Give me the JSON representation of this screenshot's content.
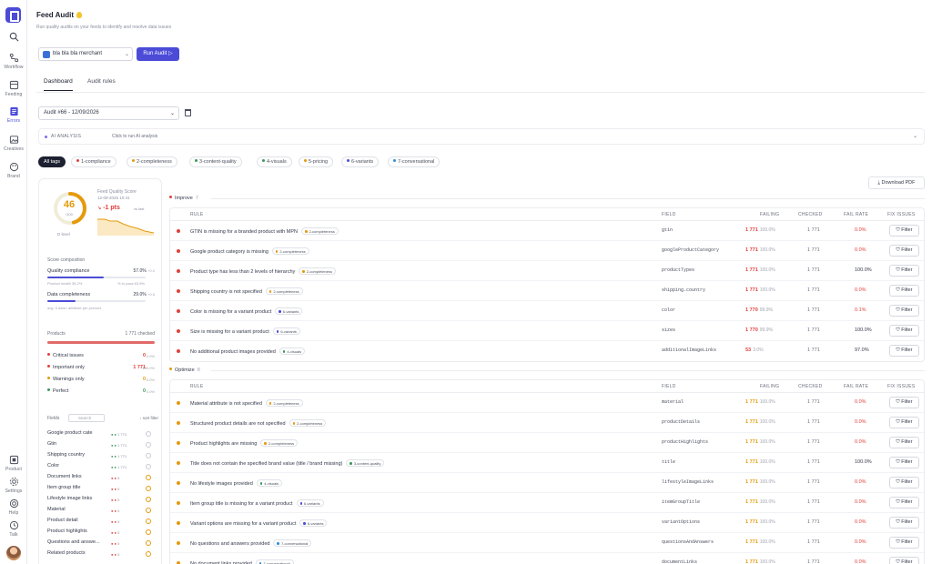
{
  "rail": {
    "items": [
      {
        "label": ""
      },
      {
        "label": "Workflow"
      },
      {
        "label": "Feeding"
      },
      {
        "label": "Errors"
      },
      {
        "label": "Creatives"
      },
      {
        "label": "Brand"
      }
    ],
    "bottom": [
      {
        "label": "Product"
      },
      {
        "label": "Settings"
      },
      {
        "label": "Help"
      },
      {
        "label": "Talk"
      }
    ]
  },
  "header": {
    "title": "Feed Audit",
    "subtitle": "Run quality audits on your feeds to identify and resolve data issues"
  },
  "merchant": {
    "name": "bla bla bla merchant"
  },
  "run_audit_label": "Run Audit ▷",
  "tabs": [
    {
      "label": "Dashboard"
    },
    {
      "label": "Audit rules"
    }
  ],
  "audit_select": {
    "value": "Audit #66 - 12/09/2026"
  },
  "ai": {
    "label": "AI ANALYSIS",
    "link": "Click to run AI analysis"
  },
  "chips": [
    {
      "label": "All tags",
      "color": ""
    },
    {
      "label": "1-compliance",
      "color": "#e0403a"
    },
    {
      "label": "2-completeness",
      "color": "#e59a0c"
    },
    {
      "label": "3-content-quality",
      "color": "#3a9a5a"
    },
    {
      "label": "4-visuals",
      "color": "#3a9a5a"
    },
    {
      "label": "5-pricing",
      "color": "#e59a0c"
    },
    {
      "label": "6-variants",
      "color": "#4b4bd8"
    },
    {
      "label": "7-conversational",
      "color": "#2f8fd8"
    }
  ],
  "score": {
    "value": "46",
    "value_pct": 46,
    "sub": "/100",
    "foot": "D level",
    "title": "Feed Quality Score",
    "date": "12-09-2026 10:41",
    "delta": "-1 pts",
    "delta_sub": "vs last",
    "composition_label": "Score composition",
    "quality_label": "Quality compliance",
    "quality_value": "57.0%",
    "quality_delta": "+0.2",
    "quality_pct": 57.0,
    "health_label": "Product health 36.2%",
    "health_right": "% to pass 63.8%",
    "data_label": "Data completeness",
    "data_value": "29.0%",
    "data_delta": "+0.5",
    "data_pct": 29.0,
    "data_note": "avg. 5 data / attribute per product"
  },
  "products": {
    "label": "Products",
    "total": "1 771 checked",
    "rows": [
      {
        "label": "Critical issues",
        "value": "0",
        "pct": "0.0%",
        "color": "#e0403a"
      },
      {
        "label": "Important only",
        "value": "1 771",
        "pct": "100.0%",
        "color": "#e0403a"
      },
      {
        "label": "Warnings only",
        "value": "0",
        "pct": "0.0%",
        "color": "#e59a0c"
      },
      {
        "label": "Perfect",
        "value": "0",
        "pct": "0.0%",
        "color": "#3a9a5a"
      }
    ]
  },
  "fields": {
    "label": "Fields",
    "search_placeholder": "Search",
    "sort": "↓ sort filter",
    "rows": [
      {
        "name": "Google product cate",
        "a": "1 771",
        "warn": false
      },
      {
        "name": "Gtin",
        "a": "1 771",
        "warn": false
      },
      {
        "name": "Shipping country",
        "a": "1 771",
        "warn": false
      },
      {
        "name": "Color",
        "a": "1 771",
        "warn": false
      },
      {
        "name": "Document links",
        "a": "0",
        "warn": true
      },
      {
        "name": "Item group title",
        "a": "0",
        "warn": true
      },
      {
        "name": "Lifestyle image links",
        "a": "0",
        "warn": true
      },
      {
        "name": "Material",
        "a": "0",
        "warn": true
      },
      {
        "name": "Product detail",
        "a": "0",
        "warn": true
      },
      {
        "name": "Product highlights",
        "a": "0",
        "warn": true
      },
      {
        "name": "Questions and answe...",
        "a": "0",
        "warn": true
      },
      {
        "name": "Related products",
        "a": "0",
        "warn": true
      }
    ]
  },
  "download_label": "⤓ Download PDF",
  "columns": {
    "rule": "RULE",
    "field": "FIELD",
    "failing": "FAILING",
    "checked": "CHECKED",
    "fail_rate": "FAIL RATE",
    "fix": "FIX ISSUES"
  },
  "filter_label": "⛉ Filter",
  "improve": {
    "label": "Improve",
    "count": "7",
    "rows": [
      {
        "rule": "GTIN is missing for a branded product with MPN",
        "tag": "2-completeness",
        "tag_color": "#e59a0c",
        "field": "gtin",
        "failing": "1 771",
        "fail_pct": "100.0%",
        "checked": "1 771",
        "rate": "0.0%"
      },
      {
        "rule": "Google product category is missing",
        "tag": "2-completeness",
        "tag_color": "#e59a0c",
        "field": "googleProductCategory",
        "failing": "1 771",
        "fail_pct": "100.0%",
        "checked": "1 771",
        "rate": "0.0%"
      },
      {
        "rule": "Product type has less than 2 levels of hierarchy",
        "tag": "2-completeness",
        "tag_color": "#e59a0c",
        "field": "productTypes",
        "failing": "1 771",
        "fail_pct": "100.0%",
        "checked": "1 771",
        "rate": "100.0%"
      },
      {
        "rule": "Shipping country is not specified",
        "tag": "2-completeness",
        "tag_color": "#e59a0c",
        "field": "shipping.country",
        "failing": "1 771",
        "fail_pct": "100.0%",
        "checked": "1 771",
        "rate": "0.0%"
      },
      {
        "rule": "Color is missing for a variant product",
        "tag": "6-variants",
        "tag_color": "#4b4bd8",
        "field": "color",
        "failing": "1 770",
        "fail_pct": "99.9%",
        "checked": "1 771",
        "rate": "0.1%"
      },
      {
        "rule": "Size is missing for a variant product",
        "tag": "6-variants",
        "tag_color": "#4b4bd8",
        "field": "sizes",
        "failing": "1 770",
        "fail_pct": "99.9%",
        "checked": "1 771",
        "rate": "100.0%"
      },
      {
        "rule": "No additional product images provided",
        "tag": "4-visuals",
        "tag_color": "#3a9a5a",
        "field": "additionalImageLinks",
        "failing": "53",
        "fail_pct": "3.0%",
        "checked": "1 771",
        "rate": "97.0%"
      }
    ]
  },
  "optimize": {
    "label": "Optimize",
    "count": "8",
    "rows": [
      {
        "rule": "Material attribute is not specified",
        "tag": "2-completeness",
        "tag_color": "#e59a0c",
        "field": "material",
        "failing": "1 771",
        "fail_pct": "100.0%",
        "checked": "1 771",
        "rate": "0.0%"
      },
      {
        "rule": "Structured product details are not specified",
        "tag": "2-completeness",
        "tag_color": "#e59a0c",
        "field": "productDetails",
        "failing": "1 771",
        "fail_pct": "100.0%",
        "checked": "1 771",
        "rate": "0.0%"
      },
      {
        "rule": "Product highlights are missing",
        "tag": "2-completeness",
        "tag_color": "#e59a0c",
        "field": "productHighlights",
        "failing": "1 771",
        "fail_pct": "100.0%",
        "checked": "1 771",
        "rate": "0.0%"
      },
      {
        "rule": "Title does not contain the specified brand value (title / brand missing)",
        "tag": "3-content-quality",
        "tag_color": "#3a9a5a",
        "field": "title",
        "failing": "1 771",
        "fail_pct": "100.0%",
        "checked": "1 771",
        "rate": "100.0%"
      },
      {
        "rule": "No lifestyle images provided",
        "tag": "4-visuals",
        "tag_color": "#3a9a5a",
        "field": "lifestyleImageLinks",
        "failing": "1 771",
        "fail_pct": "100.0%",
        "checked": "1 771",
        "rate": "0.0%"
      },
      {
        "rule": "Item group title is missing for a variant product",
        "tag": "6-variants",
        "tag_color": "#4b4bd8",
        "field": "itemGroupTitle",
        "failing": "1 771",
        "fail_pct": "100.0%",
        "checked": "1 771",
        "rate": "0.0%"
      },
      {
        "rule": "Variant options are missing for a variant product",
        "tag": "6-variants",
        "tag_color": "#4b4bd8",
        "field": "variantOptions",
        "failing": "1 771",
        "fail_pct": "100.0%",
        "checked": "1 771",
        "rate": "0.0%"
      },
      {
        "rule": "No questions and answers provided",
        "tag": "7-conversational",
        "tag_color": "#2f8fd8",
        "field": "questionsAndAnswers",
        "failing": "1 771",
        "fail_pct": "100.0%",
        "checked": "1 771",
        "rate": "0.0%"
      },
      {
        "rule": "No document links provided",
        "tag": "7-conversational",
        "tag_color": "#2f8fd8",
        "field": "documentLinks",
        "failing": "1 771",
        "fail_pct": "100.0%",
        "checked": "1 771",
        "rate": "0.0%"
      }
    ]
  },
  "colors": {
    "accent": "#4b4bd8",
    "critical": "#e0403a",
    "warning": "#e59a0c",
    "ok": "#3a9a5a"
  }
}
